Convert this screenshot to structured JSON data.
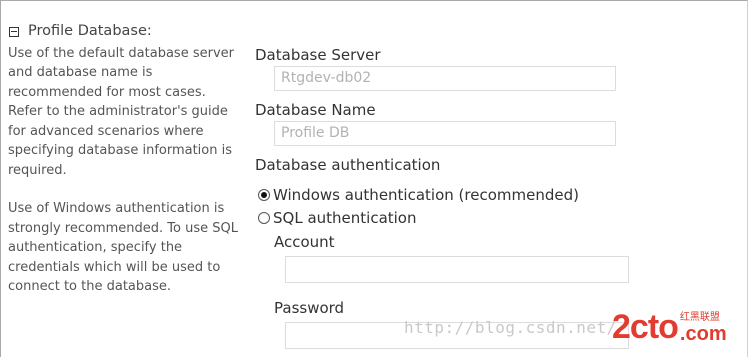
{
  "section": {
    "title": "Profile Database:",
    "description_1": "Use of the default database server and database name is recommended for most cases. Refer to the administrator's guide for advanced scenarios where specifying database information is required.",
    "description_2": "Use of Windows authentication is strongly recommended. To use SQL authentication, specify the credentials which will be used to connect to the database."
  },
  "form": {
    "server_label": "Database Server",
    "server_value": "Rtgdev-db02",
    "name_label": "Database Name",
    "name_value": "Profile DB",
    "auth_label": "Database authentication",
    "auth_options": [
      {
        "label": "Windows authentication (recommended)",
        "selected": true
      },
      {
        "label": "SQL authentication",
        "selected": false
      }
    ],
    "account_label": "Account",
    "account_value": "",
    "password_label": "Password",
    "password_value": ""
  },
  "watermark": {
    "url": "http://blog.csdn.net/",
    "brand": "2cto",
    "brand_cn": "红黑联盟",
    "brand_com": ".com"
  }
}
